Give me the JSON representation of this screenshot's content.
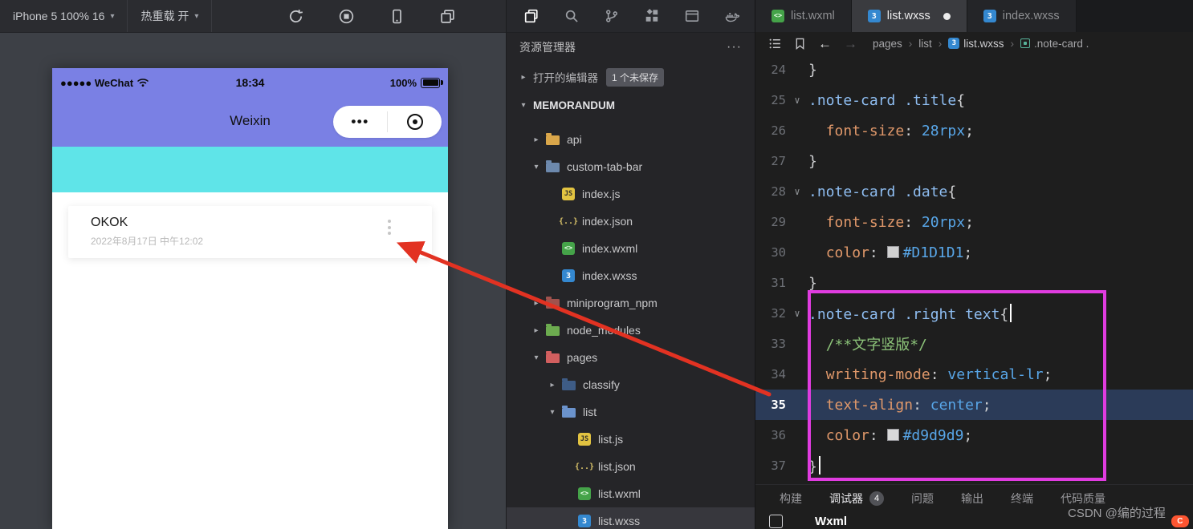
{
  "colors": {
    "phone_theme": "#7a80e4",
    "phone_banner": "#5fe4e8",
    "annotation_box": "#e03ce0",
    "annotation_arrow": "#e23222"
  },
  "sim_toolbar": {
    "device_label": "iPhone 5 100% 16",
    "hot_reload_label": "热重载 开",
    "icons": [
      "refresh-icon",
      "stop-icon",
      "phone-icon",
      "windows-icon"
    ]
  },
  "activity_bar": {
    "icons": [
      "copy-icon",
      "search-icon",
      "git-branch-icon",
      "extensions-icon",
      "window-icon",
      "docker-icon"
    ]
  },
  "phone": {
    "status": {
      "carrier": "●●●●● WeChat",
      "time": "18:34",
      "battery": "100%"
    },
    "nav_title": "Weixin",
    "capsule_more": "•••",
    "note_card": {
      "title": "OKOK",
      "date": "2022年8月17日 中午12:02"
    }
  },
  "explorer": {
    "title": "资源管理器",
    "more": "···",
    "open_editors": "打开的编辑器",
    "unsaved_badge": "1 个未保存",
    "project": "MEMORANDUM",
    "tree": [
      {
        "label": "api",
        "type": "folder",
        "color": "#d9a64a",
        "chevron": "right",
        "indent": 1
      },
      {
        "label": "custom-tab-bar",
        "type": "folder",
        "color": "#6d89ad",
        "chevron": "down",
        "indent": 1
      },
      {
        "label": "index.js",
        "type": "js",
        "indent": 2
      },
      {
        "label": "index.json",
        "type": "json",
        "indent": 2
      },
      {
        "label": "index.wxml",
        "type": "wxml",
        "indent": 2
      },
      {
        "label": "index.wxss",
        "type": "wxss",
        "indent": 2
      },
      {
        "label": "miniprogram_npm",
        "type": "folder",
        "color": "#a0524d",
        "chevron": "right",
        "indent": 1
      },
      {
        "label": "node_modules",
        "type": "folder",
        "color": "#6cab4f",
        "chevron": "right",
        "indent": 1
      },
      {
        "label": "pages",
        "type": "folder",
        "color": "#d25f5f",
        "chevron": "down",
        "indent": 1
      },
      {
        "label": "classify",
        "type": "folder",
        "color": "#3e5c86",
        "chevron": "right",
        "indent": 2
      },
      {
        "label": "list",
        "type": "folder",
        "color": "#6b93cc",
        "chevron": "down",
        "indent": 2
      },
      {
        "label": "list.js",
        "type": "js",
        "indent": 3
      },
      {
        "label": "list.json",
        "type": "json",
        "indent": 3
      },
      {
        "label": "list.wxml",
        "type": "wxml",
        "indent": 3
      },
      {
        "label": "list.wxss",
        "type": "wxss",
        "indent": 3,
        "selected": true
      }
    ]
  },
  "editor": {
    "tabs": [
      {
        "label": "list.wxml",
        "icon": "wxml",
        "active": false,
        "dirty": false
      },
      {
        "label": "list.wxss",
        "icon": "wxss",
        "active": true,
        "dirty": true
      },
      {
        "label": "index.wxss",
        "icon": "wxss",
        "active": false,
        "dirty": false
      }
    ],
    "breadcrumb": [
      {
        "label": "pages"
      },
      {
        "label": "list"
      },
      {
        "label": "list.wxss",
        "icon": "wxss",
        "bright": true
      },
      {
        "label": ".note-card .",
        "icon": "class"
      }
    ],
    "code_lines": [
      {
        "num": 24,
        "tokens": [
          {
            "t": "}",
            "c": "pn"
          }
        ]
      },
      {
        "num": 25,
        "fold": true,
        "tokens": [
          {
            "t": ".note-card .title",
            "c": "sel"
          },
          {
            "t": "{",
            "c": "pn"
          }
        ]
      },
      {
        "num": 26,
        "tokens": [
          {
            "t": "  "
          },
          {
            "t": "font-size",
            "c": "prop"
          },
          {
            "t": ": ",
            "c": "pn"
          },
          {
            "t": "28rpx",
            "c": "val"
          },
          {
            "t": ";",
            "c": "pn"
          }
        ]
      },
      {
        "num": 27,
        "tokens": [
          {
            "t": "}",
            "c": "pn"
          }
        ]
      },
      {
        "num": 28,
        "fold": true,
        "tokens": [
          {
            "t": ".note-card .date",
            "c": "sel"
          },
          {
            "t": "{",
            "c": "pn"
          }
        ]
      },
      {
        "num": 29,
        "tokens": [
          {
            "t": "  "
          },
          {
            "t": "font-size",
            "c": "prop"
          },
          {
            "t": ": ",
            "c": "pn"
          },
          {
            "t": "20rpx",
            "c": "val"
          },
          {
            "t": ";",
            "c": "pn"
          }
        ]
      },
      {
        "num": 30,
        "tokens": [
          {
            "t": "  "
          },
          {
            "t": "color",
            "c": "prop"
          },
          {
            "t": ": ",
            "c": "pn"
          },
          {
            "swatch": "#D1D1D1"
          },
          {
            "t": "#D1D1D1",
            "c": "val"
          },
          {
            "t": ";",
            "c": "pn"
          }
        ]
      },
      {
        "num": 31,
        "tokens": [
          {
            "t": "}",
            "c": "pn"
          }
        ]
      },
      {
        "num": 32,
        "fold": true,
        "tokens": [
          {
            "t": ".note-card .right text",
            "c": "sel"
          },
          {
            "t": "{",
            "c": "pn"
          },
          {
            "cursor": true
          }
        ]
      },
      {
        "num": 33,
        "tokens": [
          {
            "t": "  "
          },
          {
            "t": "/**文字竖版*/",
            "c": "cmt"
          }
        ]
      },
      {
        "num": 34,
        "tokens": [
          {
            "t": "  "
          },
          {
            "t": "writing-mode",
            "c": "prop"
          },
          {
            "t": ": ",
            "c": "pn"
          },
          {
            "t": "vertical-lr",
            "c": "val"
          },
          {
            "t": ";",
            "c": "pn"
          }
        ]
      },
      {
        "num": 35,
        "current": true,
        "tokens": [
          {
            "t": "  "
          },
          {
            "t": "text-align",
            "c": "prop"
          },
          {
            "t": ": ",
            "c": "pn"
          },
          {
            "t": "center",
            "c": "val"
          },
          {
            "t": ";",
            "c": "pn"
          }
        ]
      },
      {
        "num": 36,
        "tokens": [
          {
            "t": "  "
          },
          {
            "t": "color",
            "c": "prop"
          },
          {
            "t": ": ",
            "c": "pn"
          },
          {
            "swatch": "#d9d9d9"
          },
          {
            "t": "#d9d9d9",
            "c": "val"
          },
          {
            "t": ";",
            "c": "pn"
          }
        ]
      },
      {
        "num": 37,
        "tokens": [
          {
            "t": "}",
            "c": "pn"
          },
          {
            "cursor": true
          }
        ]
      }
    ]
  },
  "panel": {
    "tabs": [
      {
        "label": "构建"
      },
      {
        "label": "调试器",
        "badge": "4",
        "active": true
      },
      {
        "label": "问题"
      },
      {
        "label": "输出"
      },
      {
        "label": "终端"
      },
      {
        "label": "代码质量"
      }
    ],
    "debugger_first_tab": "Wxml"
  },
  "watermark": {
    "text": "CSDN @编的过程"
  }
}
